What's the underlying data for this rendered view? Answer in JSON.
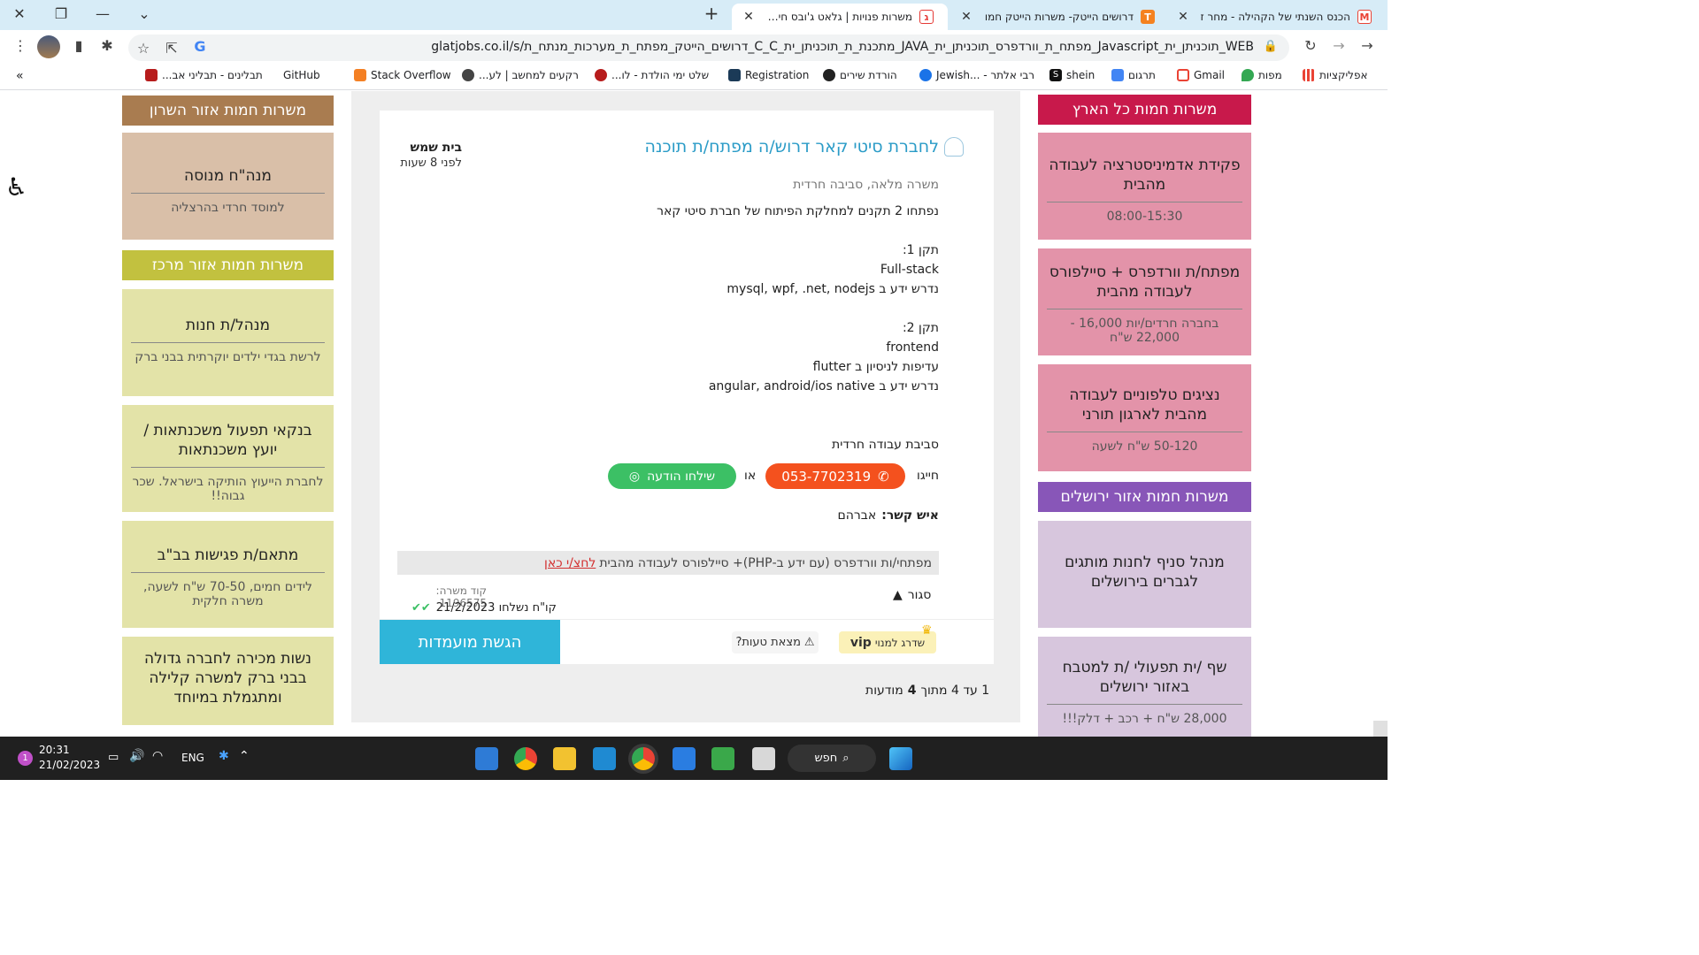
{
  "tabs": [
    {
      "title": "הכנס השנתי של הקהילה - מחר ז",
      "favicon": "gmail",
      "color": "#ea4335",
      "letter": "M"
    },
    {
      "title": "דרושים הייטק- משרות הייטק חמו",
      "favicon": "orange-t",
      "color": "#f58220",
      "letter": "T"
    },
    {
      "title": "משרות פנויות | גלאט ג'ובס חיפוש",
      "favicon": "glatjobs",
      "color": "#e53935",
      "letter": "ג"
    }
  ],
  "url": "glatjobs.co.il/s/דרושים_הייטק_מפתח_ת_מערכות_מנתח_ת_C_C_מתכנת_ת_תוכניתן_ית_C_מפתח_ת_JAVA_וורדפרס_מפתח_ת_תוכניתן_ית_Javascript_תוכניתן_ית_WEB_NodeJS_React",
  "url_display": "glatjobs.co.il/s/דרושים_הייטק_מפתח_ת_מערכות_מנתח_ת_C_C_מתכנת_ת_תוכניתן_ית_JAVA_מפתח_ת_וורדפרס_תוכניתן_ית_Javascript_תוכניתן_ית_WEB",
  "bookmarks": [
    {
      "label": "אפליקציות",
      "color": "#ea4335"
    },
    {
      "label": "מפות",
      "color": "#34a853"
    },
    {
      "label": "Gmail",
      "color": "#ea4335"
    },
    {
      "label": "תרגום",
      "color": "#4285f4"
    },
    {
      "label": "shein",
      "color": "#111111"
    },
    {
      "label": "רבי אלתר - ...Jewish",
      "color": "#1a73e8"
    },
    {
      "label": "הורדת שירים",
      "color": "#222222"
    },
    {
      "label": "Registration",
      "color": "#1b3a57"
    },
    {
      "label": "שלט ימי הולדת - לו...",
      "color": "#b71c1c"
    },
    {
      "label": "רקעים למחשב | לע...",
      "color": "#444444"
    },
    {
      "label": "Stack Overflow",
      "color": "#f48024"
    },
    {
      "label": "GitHub",
      "color": "#ffffff"
    },
    {
      "label": "תבלינים - תבליני אב...",
      "color": "#b71c1c"
    }
  ],
  "bookmarks_overflow": "»",
  "right_column": {
    "sections": [
      {
        "header": "משרות חמות כל הארץ",
        "header_color": "#c8194b",
        "card_color": "#e393a9",
        "cards": [
          {
            "title": "פקידת אדמיניסטרציה לעבודה מהבית",
            "sub": "08:00-15:30"
          },
          {
            "title": "מפתח/ת וורדפרס + סיילפורס לעבודה מהבית",
            "sub": "בחברה חרדים/יות 16,000 - 22,000 ש\"ח"
          },
          {
            "title": "נציגים טלפוניים לעבודה מהבית לארגון תורני",
            "sub": "50-120 ש\"ח לשעה"
          }
        ]
      },
      {
        "header": "משרות חמות אזור ירושלים",
        "header_color": "#8856b8",
        "card_color": "#d7c6dd",
        "cards": [
          {
            "title": "מנהל סניף לחנות מותגים לגברים בירושלים",
            "sub": ""
          },
          {
            "title": "שף /ית תפעולי /ת למטבח באזור ירושלים",
            "sub": "28,000 ש\"ח + רכב + דלק!!!"
          }
        ]
      }
    ]
  },
  "left_column": {
    "sections": [
      {
        "header": "משרות חמות אזור השרון",
        "header_color": "#a97c50",
        "card_color": "#d9bfa8",
        "cards": [
          {
            "title": "מנה\"ח מנוסה",
            "sub": "למוסד חרדי בהרצליה"
          }
        ]
      },
      {
        "header": "משרות חמות אזור מרכז",
        "header_color": "#c2c13f",
        "card_color": "#e3e3a8",
        "cards": [
          {
            "title": "מנהל/ת חנות",
            "sub": "לרשת בגדי ילדים יוקרתית בבני ברק"
          },
          {
            "title": "בנקאי תפעול משכנתאות / יועץ משכנתאות",
            "sub": "לחברת הייעוץ הותיקה בישראל. שכר גבוה!!"
          },
          {
            "title": "מתאם/ת פגישות בב\"ב",
            "sub": "לידים חמים, 70-50 ש\"ח לשעה, משרה חלקית"
          },
          {
            "title": "נשות מכירה לחברה גדולה בבני ברק למשרה קלילה ומתגמלת במיוחד",
            "sub": ""
          }
        ]
      }
    ]
  },
  "job": {
    "title": "לחברת סיטי קאר דרוש/ה מפתח/ת תוכנה",
    "location": "בית שמש",
    "posted": "לפני 8 שעות",
    "meta": "משרה מלאה, סביבה חרדית",
    "description": [
      "נפתחו 2 תקנים למחלקת הפיתוח של חברת סיטי קאר",
      "",
      "תקן 1:",
      "Full-stack",
      "נדרש ידע ב mysql, wpf, .net, nodejs",
      "",
      "תקן 2:",
      "frontend",
      "עדיפות לניסיון ב flutter",
      "נדרש ידע ב angular, android/ios native"
    ],
    "environment": "סביבת עבודה חרדית",
    "dial_label": "חייגו",
    "phone": "053-7702319",
    "or_label": "או",
    "whatsapp_label": "שילחו הודעה",
    "contact_label": "איש קשר:",
    "contact_name": "אברהם",
    "promo_text": "מפתחי/ות וורדפרס (עם ידע ב-PHP)+ סיילפורס לעבודה מהבית",
    "promo_link": "לחצ/י כאן",
    "close_label": "סגור",
    "code_label": "קוד משרה: 1196575",
    "sent_label": "קו\"ח נשלחו 21/2/2023",
    "vip_label": "שדרג למנוי",
    "vip_badge": "vip",
    "report_label": "מצאת טעות?",
    "submit_label": "הגשת מועמדות"
  },
  "pagination": {
    "prefix": "1 עד 4 מתוך",
    "total": "4",
    "suffix": "מודעות"
  },
  "taskbar": {
    "time": "20:31",
    "date": "21/02/2023",
    "lang": "ENG",
    "search": "חפש",
    "notif_count": "1"
  },
  "colors": {
    "tabbar": "#d7ecf7",
    "phone_btn": "#f4511e",
    "whatsapp_btn": "#3cc065",
    "submit_btn": "#2fb5d9",
    "title_blue": "#2a9bc7"
  }
}
